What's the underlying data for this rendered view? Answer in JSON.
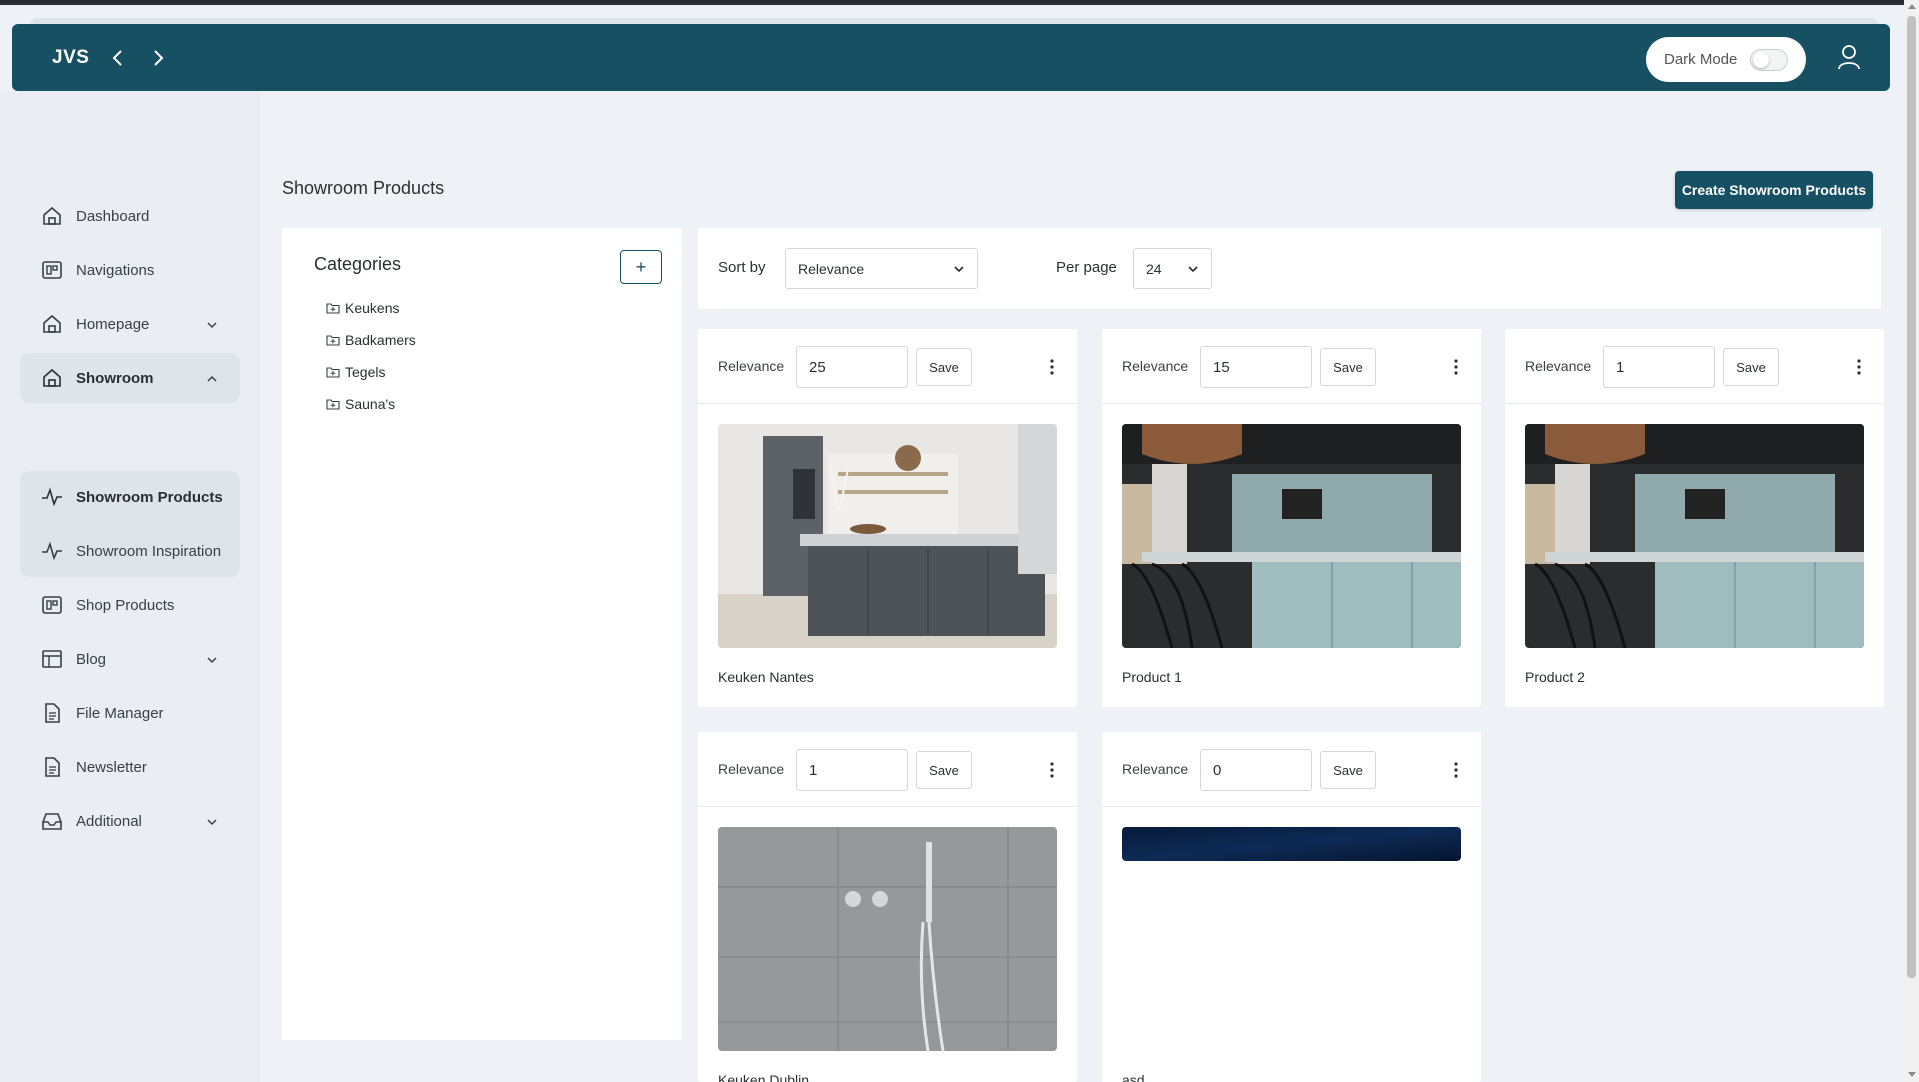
{
  "header": {
    "brand": "JVS",
    "back_icon": "chevron-left-icon",
    "forward_icon": "chevron-right-icon",
    "dark_mode_label": "Dark Mode",
    "dark_mode_on": false,
    "user_icon": "user-icon"
  },
  "sidebar": {
    "items": [
      {
        "label": "Dashboard",
        "icon": "home-icon"
      },
      {
        "label": "Navigations",
        "icon": "layout-icon"
      },
      {
        "label": "Homepage",
        "icon": "home-icon",
        "expandable": true
      },
      {
        "label": "Showroom",
        "icon": "home-icon",
        "expanded": true
      },
      {
        "label": "Showroom Products",
        "icon": "activity-icon",
        "current": true
      },
      {
        "label": "Showroom Inspiration",
        "icon": "activity-icon"
      },
      {
        "label": "Shop Products",
        "icon": "layout-icon"
      },
      {
        "label": "Blog",
        "icon": "table-icon",
        "expandable": true
      },
      {
        "label": "File Manager",
        "icon": "file-icon"
      },
      {
        "label": "Newsletter",
        "icon": "file-icon"
      },
      {
        "label": "Additional",
        "icon": "inbox-icon",
        "expandable": true
      }
    ]
  },
  "page": {
    "title": "Showroom Products",
    "create_button": "Create Showroom Products"
  },
  "categories": {
    "title": "Categories",
    "add_label": "+",
    "items": [
      "Keukens",
      "Badkamers",
      "Tegels",
      "Sauna's"
    ]
  },
  "toolbar": {
    "sort_label": "Sort by",
    "sort_value": "Relevance",
    "per_page_label": "Per page",
    "per_page_value": "24"
  },
  "products": [
    {
      "relevance_label": "Relevance",
      "relevance": "25",
      "save": "Save",
      "name": "Keuken Nantes"
    },
    {
      "relevance_label": "Relevance",
      "relevance": "15",
      "save": "Save",
      "name": "Product 1"
    },
    {
      "relevance_label": "Relevance",
      "relevance": "1",
      "save": "Save",
      "name": "Product 2"
    },
    {
      "relevance_label": "Relevance",
      "relevance": "1",
      "save": "Save",
      "name": "Keuken Dublin"
    },
    {
      "relevance_label": "Relevance",
      "relevance": "0",
      "save": "Save",
      "name": "asd"
    }
  ],
  "colors": {
    "primary": "#174f63",
    "background": "#eef1f6",
    "sidebar": "#eaedf3"
  }
}
